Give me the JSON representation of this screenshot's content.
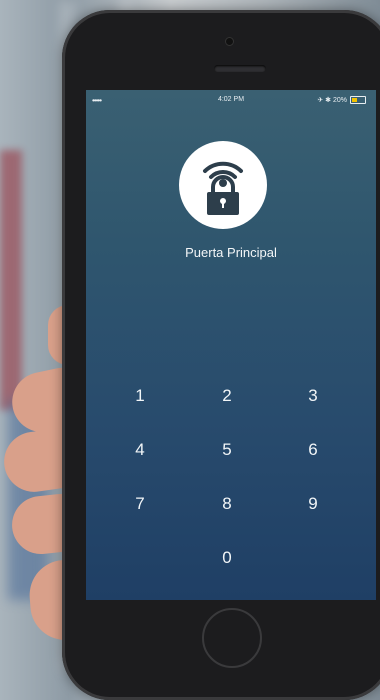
{
  "status_bar": {
    "signal": "•••••",
    "time": "4:02 PM",
    "indicators": "✈ ✱ 20%",
    "battery_color": "#f2c200"
  },
  "lock": {
    "icon": "wifi-padlock-icon",
    "title": "Puerta Principal"
  },
  "keypad": {
    "keys": [
      "1",
      "2",
      "3",
      "4",
      "5",
      "6",
      "7",
      "8",
      "9",
      "0"
    ]
  },
  "colors": {
    "screen_top": "#3a6072",
    "screen_bottom": "#1f3f65",
    "icon_dark": "#2d3e4b"
  }
}
